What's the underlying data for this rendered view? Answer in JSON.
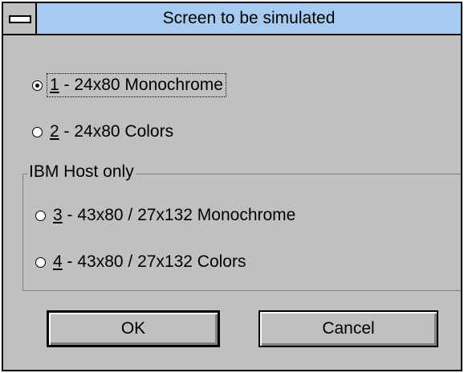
{
  "dialog": {
    "title": "Screen to be simulated",
    "options": [
      {
        "mnemonic": "1",
        "rest": " - 24x80 Monochrome",
        "selected": true
      },
      {
        "mnemonic": "2",
        "rest": " - 24x80 Colors",
        "selected": false
      }
    ],
    "group": {
      "label": "IBM Host only",
      "options": [
        {
          "mnemonic": "3",
          "rest": " - 43x80 / 27x132 Monochrome",
          "selected": false
        },
        {
          "mnemonic": "4",
          "rest": " - 43x80 / 27x132 Colors",
          "selected": false
        }
      ]
    },
    "buttons": {
      "ok_label": "OK",
      "cancel_label": "Cancel"
    }
  }
}
